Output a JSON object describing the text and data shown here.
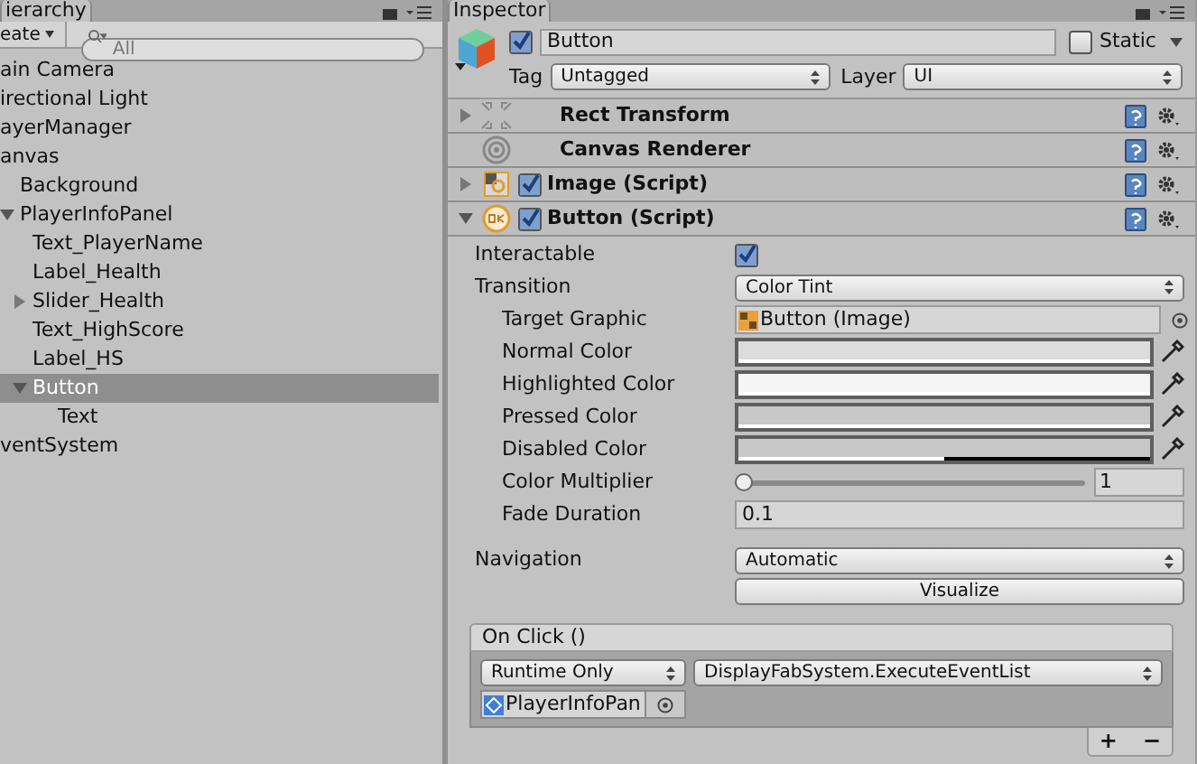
{
  "hierarchy": {
    "tab": "ierarchy",
    "create_menu": "eate",
    "search": {
      "placeholder": "All"
    },
    "items": [
      {
        "label": "ain Camera",
        "selected": false
      },
      {
        "label": "irectional Light",
        "selected": false
      },
      {
        "label": "ayerManager",
        "selected": false
      },
      {
        "label": "anvas",
        "selected": false,
        "children": [
          {
            "label": "Background",
            "selected": false
          },
          {
            "label": "PlayerInfoPanel",
            "selected": false,
            "expanded": true,
            "children": [
              {
                "label": "Text_PlayerName",
                "selected": false
              },
              {
                "label": "Label_Health",
                "selected": false
              },
              {
                "label": "Slider_Health",
                "selected": false,
                "expanded": false
              },
              {
                "label": "Text_HighScore",
                "selected": false
              },
              {
                "label": "Label_HS",
                "selected": false
              },
              {
                "label": "Button",
                "selected": true,
                "expanded": true,
                "children": [
                  {
                    "label": "Text",
                    "selected": false
                  }
                ]
              }
            ]
          }
        ]
      },
      {
        "label": "ventSystem",
        "selected": false
      }
    ]
  },
  "inspector": {
    "tab": "Inspector",
    "object": {
      "active": true,
      "name": "Button",
      "static": false,
      "static_label": "Static",
      "tag_label": "Tag",
      "tag": "Untagged",
      "layer_label": "Layer",
      "layer": "UI"
    },
    "components": [
      {
        "kind": "rect",
        "name": "Rect Transform",
        "expanded": false
      },
      {
        "kind": "renderer",
        "name": "Canvas Renderer"
      },
      {
        "kind": "image",
        "name": "Image (Script)",
        "expanded": false,
        "enabled": true
      },
      {
        "kind": "button",
        "name": "Button (Script)",
        "expanded": true,
        "enabled": true
      }
    ],
    "properties": [
      {
        "kind": "checkbox",
        "label": "Interactable",
        "checked": true
      },
      {
        "kind": "dropdown",
        "label": "Transition",
        "value": "Color Tint",
        "children": [
          {
            "kind": "object",
            "label": "Target Graphic",
            "value": "Button (Image)"
          },
          {
            "kind": "color",
            "label": "Normal Color",
            "color": "#dcdcdc",
            "level": 1
          },
          {
            "kind": "color",
            "label": "Highlighted Color",
            "color": "#f5f5f5",
            "level": 1
          },
          {
            "kind": "color",
            "label": "Pressed Color",
            "color": "#c8c8c8",
            "level": 1
          },
          {
            "kind": "color",
            "label": "Disabled Color",
            "color": "#c8c8c8",
            "level": 0.5
          },
          {
            "kind": "slider",
            "label": "Color Multiplier",
            "level": 0,
            "value": "1"
          },
          {
            "kind": "number",
            "label": "Fade Duration",
            "value": "0.1"
          }
        ]
      }
    ],
    "navigation": {
      "label": "Navigation",
      "value": "Automatic",
      "button": "Visualize"
    },
    "on_click": {
      "title": "On Click ()",
      "mode": "Runtime Only",
      "function": "DisplayFabSystem.ExecuteEventList",
      "target": "PlayerInfoPan",
      "add": "+",
      "remove": "−"
    }
  }
}
